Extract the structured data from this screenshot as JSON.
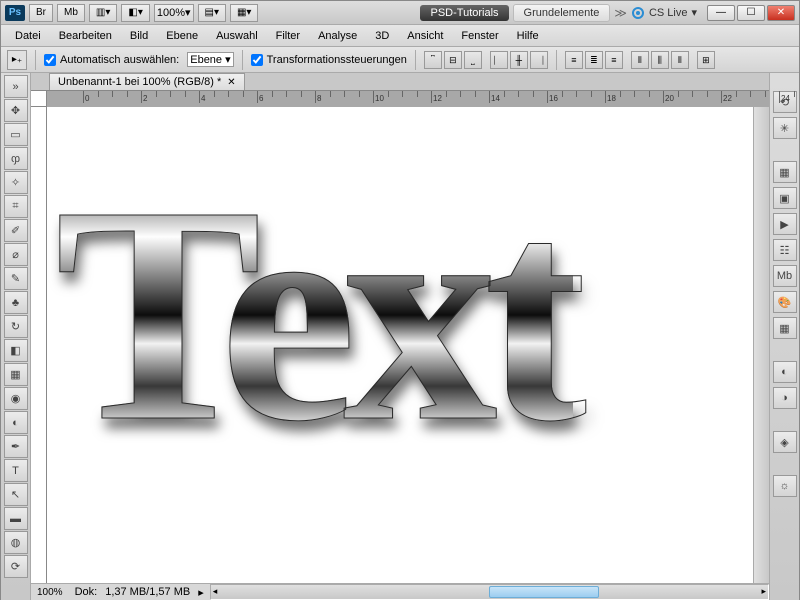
{
  "title_bar": {
    "zoom_value": "100%",
    "workspace_pill": "PSD-Tutorials",
    "workspace_other": "Grundelemente",
    "cs_live": "CS Live"
  },
  "window_buttons": {
    "min": "—",
    "max": "☐",
    "close": "✕"
  },
  "menu": {
    "items": [
      "Datei",
      "Bearbeiten",
      "Bild",
      "Ebene",
      "Auswahl",
      "Filter",
      "Analyse",
      "3D",
      "Ansicht",
      "Fenster",
      "Hilfe"
    ]
  },
  "options": {
    "auto_select_label": "Automatisch auswählen:",
    "auto_select_target": "Ebene",
    "transform_label": "Transformationssteuerungen"
  },
  "document": {
    "tab_title": "Unbenannt-1 bei 100% (RGB/8) *",
    "canvas_text": "Text"
  },
  "ruler": {
    "marks": [
      0,
      2,
      4,
      6,
      8,
      10,
      12,
      14,
      16,
      18,
      20,
      22,
      24
    ]
  },
  "status": {
    "zoom": "100%",
    "doc_size_label": "Dok:",
    "doc_size_value": "1,37 MB/1,57 MB"
  },
  "tools": {
    "left": [
      "move",
      "marquee",
      "lasso",
      "wand",
      "crop",
      "eyedropper",
      "healing",
      "brush",
      "stamp",
      "history",
      "eraser",
      "gradient",
      "blur",
      "dodge",
      "pen",
      "type",
      "path",
      "shape",
      "3d",
      "hand"
    ],
    "right": [
      "history",
      "3d-axis",
      "info",
      "nav",
      "play",
      "channels",
      "mb",
      "color",
      "swatches",
      "",
      "adjust",
      "layers",
      "",
      "styles",
      "",
      "artboard"
    ]
  }
}
